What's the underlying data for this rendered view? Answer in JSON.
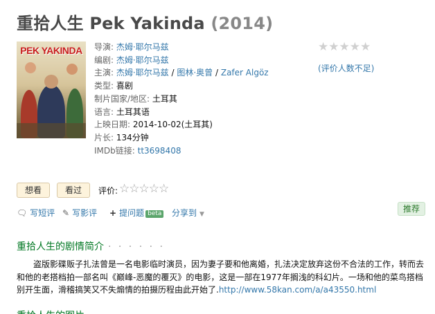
{
  "title": {
    "cn": "重拾人生",
    "original": "Pek Yakinda",
    "year": "(2014)"
  },
  "poster": {
    "title_text": "PEK YAKINDA"
  },
  "info": {
    "director_label": "导演: ",
    "director": "杰姆·耶尔马兹",
    "writer_label": "编剧: ",
    "writer": "杰姆·耶尔马兹",
    "cast_label": "主演: ",
    "cast": [
      "杰姆·耶尔马兹",
      "图林·奥曾",
      "Zafer Algöz"
    ],
    "cast_sep": " / ",
    "genre_label": "类型: ",
    "genre": "喜剧",
    "country_label": "制片国家/地区: ",
    "country": "土耳其",
    "language_label": "语言: ",
    "language": "土耳其语",
    "release_label": "上映日期: ",
    "release": "2014-10-02(土耳其)",
    "runtime_label": "片长: ",
    "runtime": "134分钟",
    "imdb_label": "IMDb链接: ",
    "imdb": "tt3698408"
  },
  "rating": {
    "stars": "★★★★★",
    "note": "(评价人数不足)"
  },
  "buttons": {
    "want": "想看",
    "seen": "看过",
    "rate_label": "评价:",
    "rate_stars": "☆☆☆☆☆"
  },
  "actions": {
    "comment": "写短评",
    "review": "写影评",
    "question": "提问题",
    "beta": "beta",
    "share": "分享到",
    "recommend": "推荐"
  },
  "icons": {
    "comment": "speech-bubble-icon",
    "review": "pencil-icon",
    "question": "plus-icon",
    "share_caret": "chevron-down-icon"
  },
  "summary": {
    "heading": "重拾人生的剧情简介",
    "dots": "· · · · · ·",
    "text": "盗版影碟贩子扎法曾是一名电影临时演员，因为妻子要和他离婚，扎法决定放弃这份不合法的工作，转而去和他的老搭档拍一部名叫《巅峰-恶魔的覆灭》的电影，这是一部在1977年搁浅的科幻片。一场和他的菜鸟搭档别开生面，滑稽搞笑又不失煽情的拍摄历程由此开始了.",
    "link": "http://www.58kan.com/a/a43550.html"
  },
  "next_section": {
    "heading": "重拾人生的图片"
  },
  "colors": {
    "link": "#3377aa",
    "section": "#007722",
    "title": "#494949",
    "year": "#888888"
  }
}
